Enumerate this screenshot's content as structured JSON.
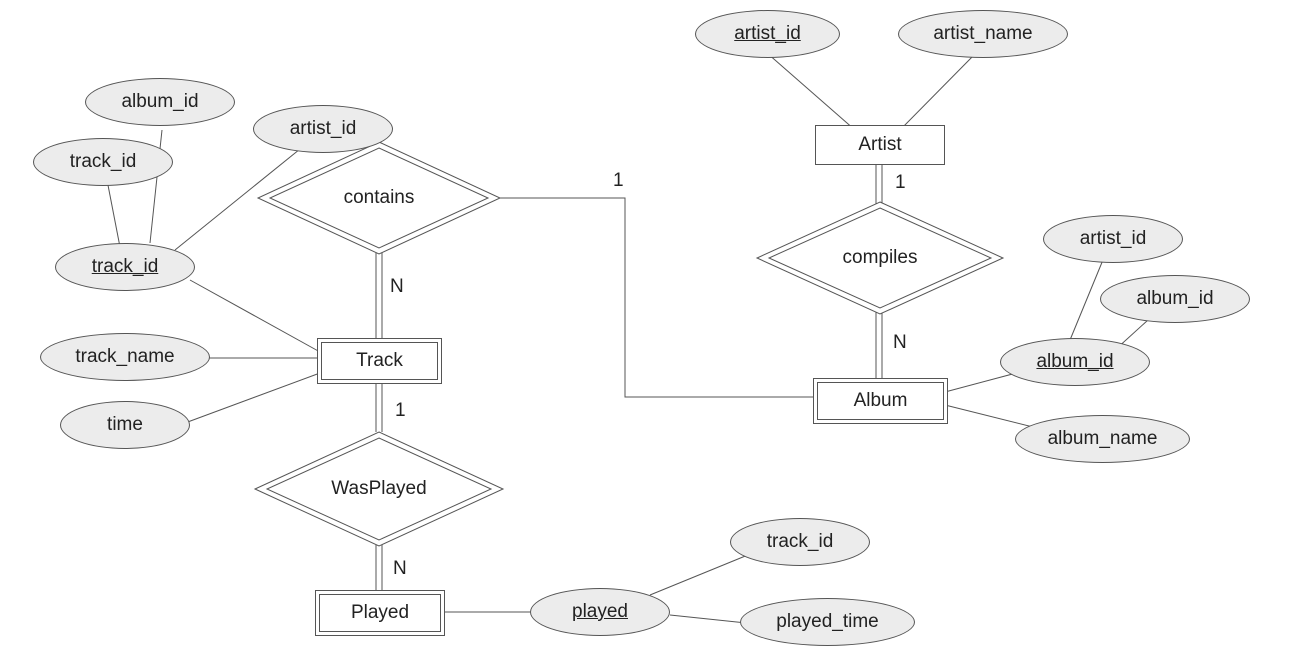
{
  "entities": {
    "artist": "Artist",
    "album": "Album",
    "track": "Track",
    "played": "Played"
  },
  "relationships": {
    "contains": "contains",
    "compiles": "compiles",
    "wasplayed": "WasPlayed"
  },
  "attributes": {
    "artist_artist_id": "artist_id",
    "artist_artist_name": "artist_name",
    "album_album_id_pk": "album_id",
    "album_album_name": "album_name",
    "album_artist_id": "artist_id",
    "album_album_id_discrim": "album_id",
    "track_track_id_pk": "track_id",
    "track_track_name": "track_name",
    "track_time": "time",
    "track_track_id_discrim": "track_id",
    "track_album_id": "album_id",
    "track_artist_id": "artist_id",
    "played_played_pk": "played",
    "played_track_id": "track_id",
    "played_played_time": "played_time"
  },
  "cardinalities": {
    "contains_album": "1",
    "contains_track": "N",
    "compiles_artist": "1",
    "compiles_album": "N",
    "wasplayed_track": "1",
    "wasplayed_played": "N"
  }
}
